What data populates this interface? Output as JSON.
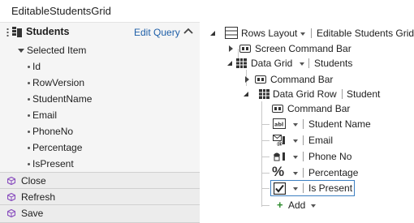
{
  "window": {
    "title": "EditableStudentsGrid"
  },
  "data_panel": {
    "title": "Students",
    "edit_query_label": "Edit Query",
    "selected_item_label": "Selected Item",
    "fields": [
      "Id",
      "RowVersion",
      "StudentName",
      "Email",
      "PhoneNo",
      "Percentage",
      "IsPresent"
    ],
    "methods": [
      "Close",
      "Refresh",
      "Save"
    ]
  },
  "content_tree": {
    "root": {
      "label": "Rows Layout",
      "name": "Editable Students Grid"
    },
    "screen_command_bar": "Screen Command Bar",
    "data_grid": {
      "label": "Data Grid",
      "name": "Students"
    },
    "grid_command_bar": "Command Bar",
    "data_grid_row": {
      "label": "Data Grid Row",
      "name": "Student"
    },
    "row_command_bar": "Command Bar",
    "columns": [
      {
        "label": "Student Name",
        "icon": "textbox-icon"
      },
      {
        "label": "Email",
        "icon": "email-address-editor-icon"
      },
      {
        "label": "Phone No",
        "icon": "phone-number-editor-icon"
      },
      {
        "label": "Percentage",
        "icon": "percent-editor-icon"
      },
      {
        "label": "Is Present",
        "icon": "checkbox-icon",
        "selected": true
      }
    ],
    "add_label": "Add"
  },
  "colors": {
    "link": "#1e5fa8",
    "selection_border": "#3c7fc1",
    "add_plus": "#2e8b2e",
    "method_icon": "#8a4fbf"
  }
}
